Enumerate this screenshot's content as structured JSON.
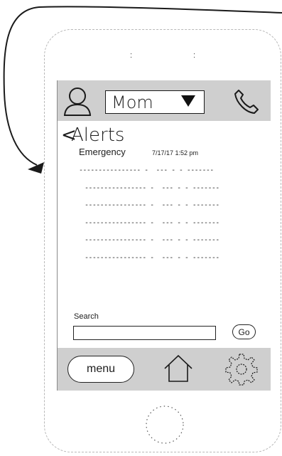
{
  "contact": {
    "name": "Mom"
  },
  "alerts": {
    "title": "Alerts",
    "back_symbol": "<",
    "latest": {
      "name": "Emergency",
      "time": "7/17/17 1:52 pm"
    },
    "rows": [
      "---------------- -  --- - - -------",
      "---------------- -  --- - - -------",
      "---------------- -  --- - - -------",
      "---------------- -  --- - - -------",
      "---------------- -  --- - - -------",
      "---------------- -  --- - - -------"
    ]
  },
  "search": {
    "label": "Search",
    "value": "",
    "go_label": "Go"
  },
  "bottom_nav": {
    "menu_label": "menu"
  },
  "icons": {
    "avatar": "user-icon",
    "dropdown": "triangle-down-icon",
    "call": "phone-icon",
    "home": "home-icon",
    "settings": "gear-icon"
  },
  "colors": {
    "bar_background": "#cfcfcf",
    "stroke": "#1a1a1a"
  }
}
